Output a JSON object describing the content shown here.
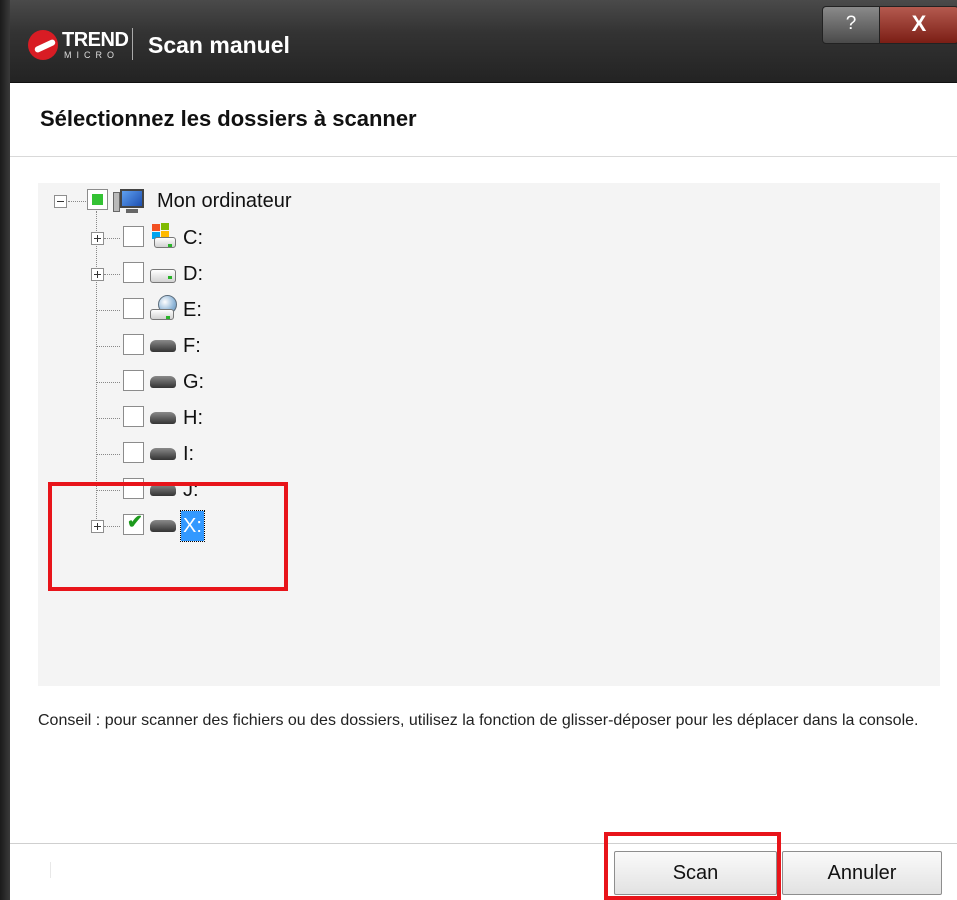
{
  "window": {
    "brand": "TREND",
    "brand_sub": "MICRO",
    "title": "Scan manuel",
    "help_label": "?",
    "close_label": "X"
  },
  "heading": "Sélectionnez les dossiers à scanner",
  "tree": {
    "root": {
      "label": "Mon ordinateur",
      "icon": "computer-icon",
      "checkbox": "partial"
    },
    "drives": [
      {
        "label": "C:",
        "icon": "windows-drive-icon",
        "expandable": true,
        "checked": false
      },
      {
        "label": "D:",
        "icon": "hard-drive-icon",
        "expandable": true,
        "checked": false
      },
      {
        "label": "E:",
        "icon": "network-drive-icon",
        "expandable": false,
        "checked": false
      },
      {
        "label": "F:",
        "icon": "removable-drive-icon",
        "expandable": false,
        "checked": false
      },
      {
        "label": "G:",
        "icon": "removable-drive-icon",
        "expandable": false,
        "checked": false
      },
      {
        "label": "H:",
        "icon": "removable-drive-icon",
        "expandable": false,
        "checked": false
      },
      {
        "label": "I:",
        "icon": "removable-drive-icon",
        "expandable": false,
        "checked": false
      },
      {
        "label": "J:",
        "icon": "removable-drive-icon",
        "expandable": false,
        "checked": false
      },
      {
        "label": "X:",
        "icon": "removable-drive-icon",
        "expandable": true,
        "checked": true,
        "selected": true
      }
    ]
  },
  "tip": "Conseil : pour scanner des fichiers ou des dossiers, utilisez la fonction de glisser-déposer pour les déplacer dans la console.",
  "buttons": {
    "scan": "Scan",
    "cancel": "Annuler"
  },
  "colors": {
    "highlight_box": "#e8141a",
    "selection": "#3399ff",
    "check": "#1d9a1d"
  }
}
